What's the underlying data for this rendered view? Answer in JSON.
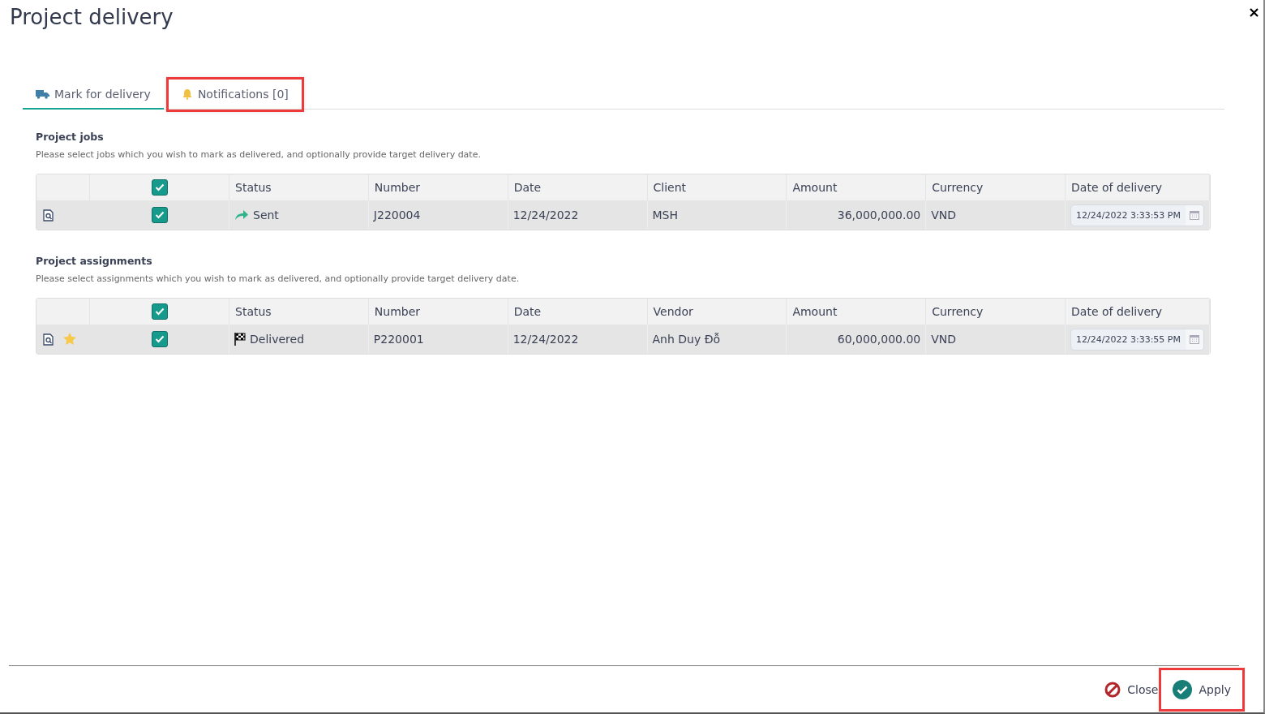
{
  "window": {
    "title": "Project delivery"
  },
  "tabs": [
    {
      "label": "Mark for delivery",
      "selected": true,
      "highlighted": false
    },
    {
      "label": "Notifications [0]",
      "selected": false,
      "highlighted": true
    }
  ],
  "sections": [
    {
      "title": "Project jobs",
      "description": "Please select jobs which you wish to mark as delivered, and optionally provide target delivery date.",
      "all_checked": true,
      "columns": [
        "Status",
        "Number",
        "Date",
        "Client",
        "Amount",
        "Currency",
        "Date of delivery"
      ],
      "rows": [
        {
          "starred": false,
          "checked": true,
          "status": {
            "kind": "sent",
            "label": "Sent"
          },
          "number": "J220004",
          "date": "12/24/2022",
          "party": "MSH",
          "amount": "36,000,000.00",
          "currency": "VND",
          "delivery_date": "12/24/2022 3:33:53 PM"
        }
      ]
    },
    {
      "title": "Project assignments",
      "description": "Please select assignments which you wish to mark as delivered, and optionally provide target delivery date.",
      "all_checked": true,
      "columns": [
        "Status",
        "Number",
        "Date",
        "Vendor",
        "Amount",
        "Currency",
        "Date of delivery"
      ],
      "rows": [
        {
          "starred": true,
          "checked": true,
          "status": {
            "kind": "delivered",
            "label": "Delivered"
          },
          "number": "P220001",
          "date": "12/24/2022",
          "party": "Anh Duy Đỗ",
          "amount": "60,000,000.00",
          "currency": "VND",
          "delivery_date": "12/24/2022 3:33:55 PM"
        }
      ]
    }
  ],
  "footer": {
    "buttons": [
      {
        "kind": "close",
        "label": "Close",
        "highlighted": false
      },
      {
        "kind": "apply",
        "label": "Apply",
        "highlighted": true
      }
    ]
  }
}
